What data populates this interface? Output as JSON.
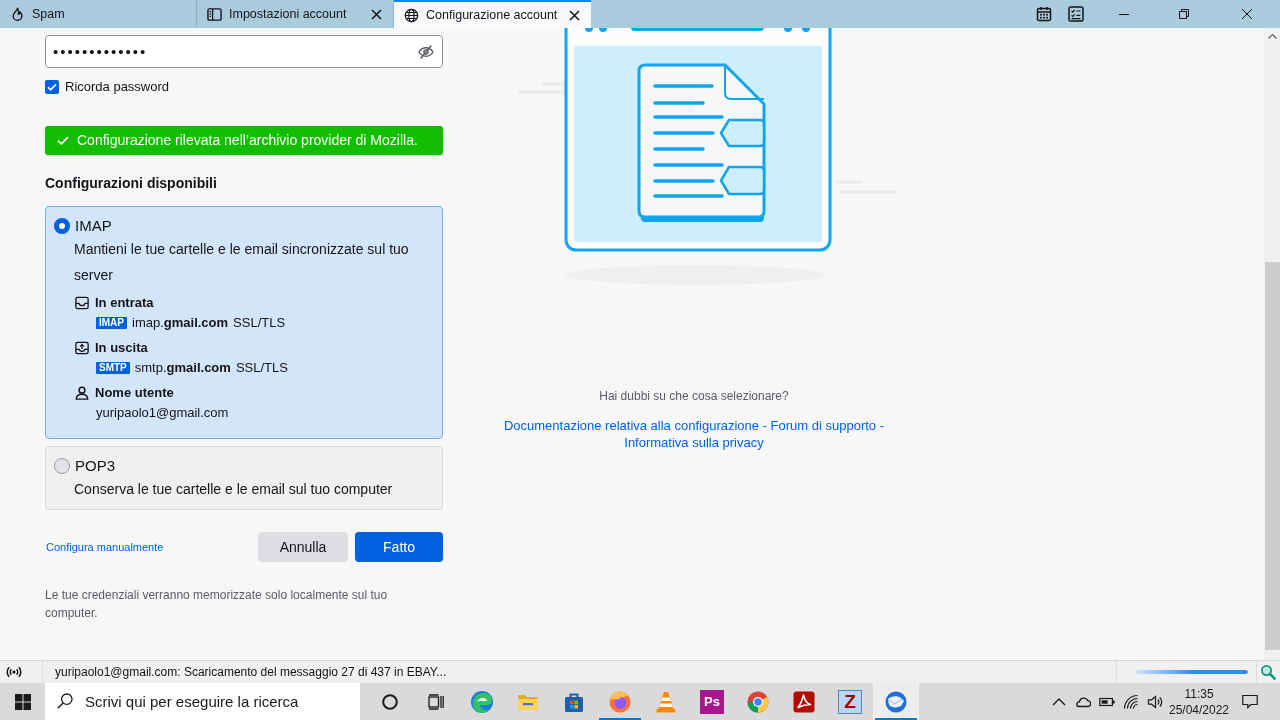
{
  "tabs": [
    {
      "label": "Spam",
      "kind": "junk",
      "selected": false,
      "closable": false
    },
    {
      "label": "Impostazioni account",
      "kind": "settings",
      "selected": false,
      "closable": true
    },
    {
      "label": "Configurazione account",
      "kind": "web",
      "selected": true,
      "closable": true
    }
  ],
  "password": {
    "value": "•••••••••••••",
    "remember": {
      "label": "Ricorda password",
      "checked": true
    }
  },
  "notice": "Configurazione rilevata nell’archivio provider di Mozilla.",
  "configurations": {
    "heading": "Configurazioni disponibili",
    "options": [
      {
        "label": "IMAP",
        "selected": true,
        "description": "Mantieni le tue cartelle e le email sincronizzate sul tuo server",
        "details": [
          {
            "kind": "incoming",
            "title": "In entrata",
            "protocol": "IMAP",
            "host": "imap.**gmail.com**",
            "security": "SSL/TLS"
          },
          {
            "kind": "outgoing",
            "title": "In uscita",
            "protocol": "SMTP",
            "host": "smtp.**gmail.com**",
            "security": "SSL/TLS"
          },
          {
            "kind": "user",
            "title": "Nome utente",
            "value": "yuripaolo1@gmail.com"
          }
        ]
      },
      {
        "label": "POP3",
        "selected": false,
        "description": "Conserva le tue cartelle e le email sul tuo computer"
      }
    ]
  },
  "manual_link": "Configura manualmente",
  "buttons": [
    {
      "label": "Annulla",
      "kind": "secondary"
    },
    {
      "label": "Fatto",
      "kind": "primary"
    }
  ],
  "privacy_note": "Le tue credenziali verranno memorizzate solo localmente sul tuo computer.",
  "help": {
    "question": "Hai dubbi su che cosa selezionare?",
    "links": [
      {
        "label": "Documentazione relativa alla configurazione"
      },
      {
        "label": "Forum di supporto"
      },
      {
        "label": "Informativa sulla privacy"
      }
    ],
    "separator": "-"
  },
  "status_bar": {
    "message": "yuripaolo1@gmail.com: Scaricamento del messaggio 27 di 437 in EBAY...",
    "progress": {
      "level": 1
    }
  },
  "taskbar": {
    "search": {
      "placeholder": "Scrivi qui per eseguire la ricerca"
    },
    "apps": [
      {
        "kind": "swirl",
        "running": false,
        "active": false
      },
      {
        "kind": "folder",
        "running": false,
        "active": false
      },
      {
        "kind": "bag",
        "running": false,
        "active": false
      },
      {
        "kind": "fox",
        "running": true,
        "active": false
      },
      {
        "kind": "cone",
        "running": false,
        "active": false
      },
      {
        "kind": "ps_tile",
        "glyph": "Ps",
        "running": false,
        "active": false
      },
      {
        "kind": "ring",
        "running": false,
        "active": false
      },
      {
        "kind": "pdf",
        "running": false,
        "active": false
      },
      {
        "kind": "z_tile",
        "glyph": "Z",
        "running": false,
        "active": false
      },
      {
        "kind": "bird",
        "running": true,
        "active": true
      }
    ],
    "clock": {
      "time": "11:35",
      "date": "25/04/2022"
    }
  }
}
